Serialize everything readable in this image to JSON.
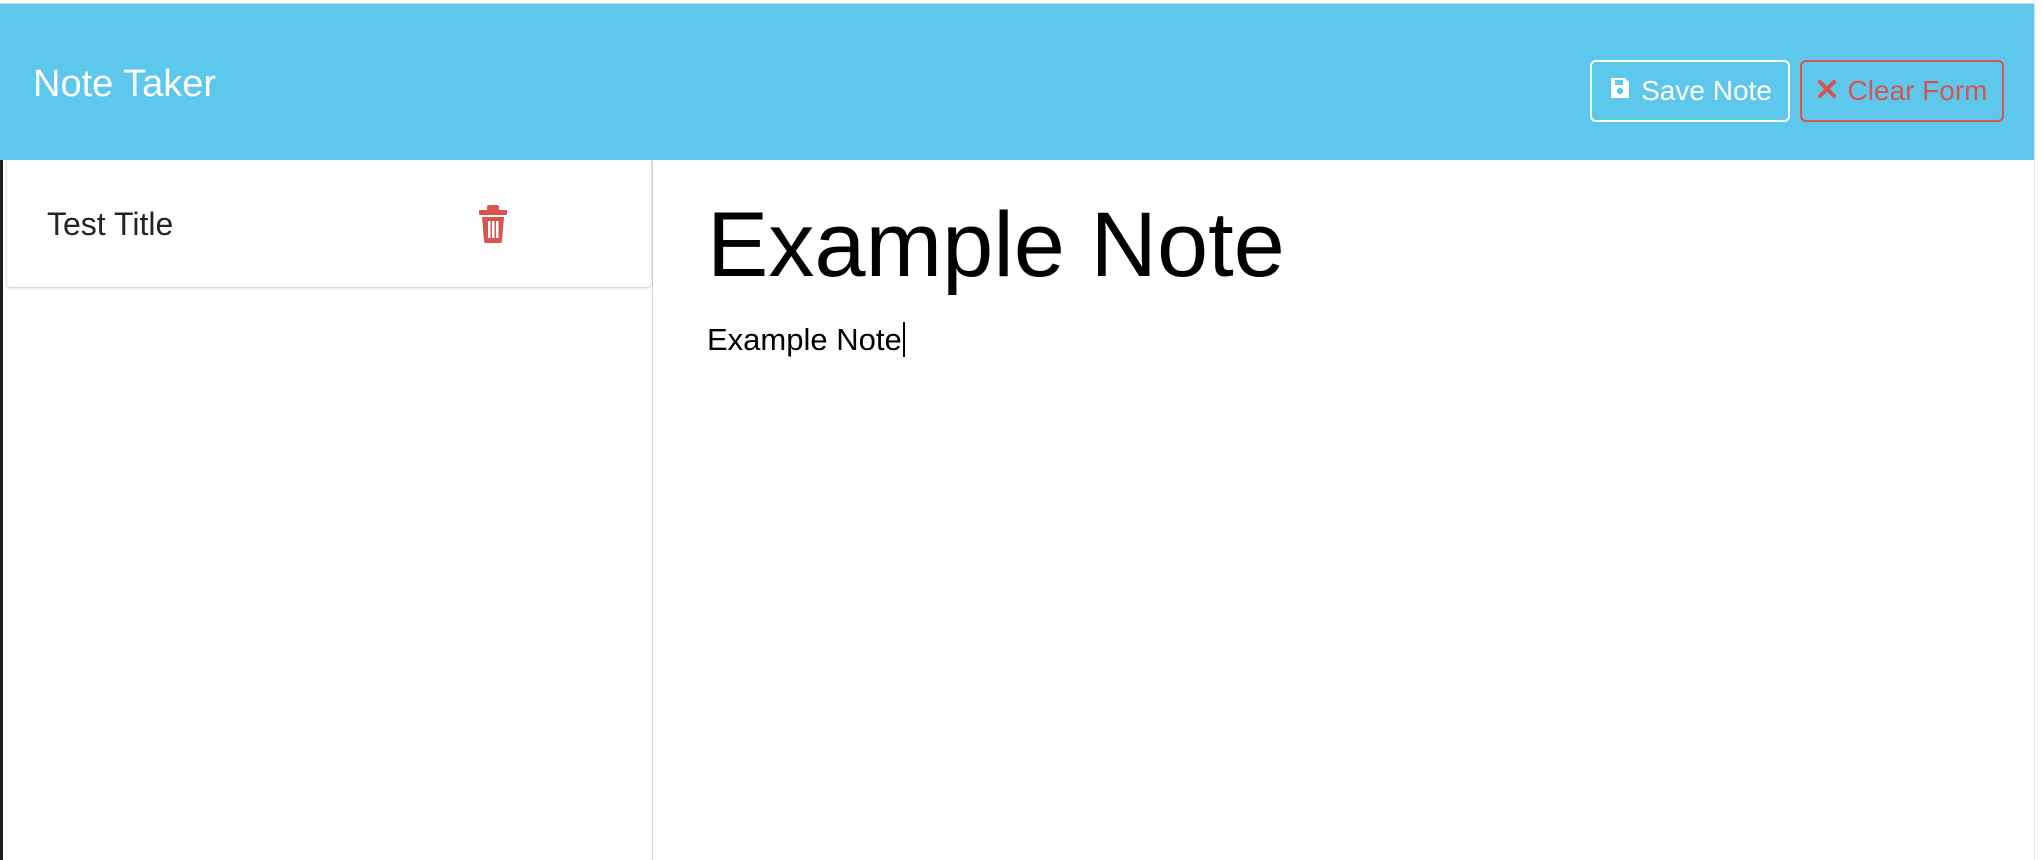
{
  "header": {
    "title": "Note Taker",
    "save_label": "Save Note",
    "clear_label": "Clear Form",
    "background_color": "#5dc7ec",
    "save_icon": "save-icon",
    "clear_icon": "close-icon"
  },
  "sidebar": {
    "notes": [
      {
        "title": "Test Title",
        "action_icon": "trash-icon",
        "action_color": "#d9534f"
      }
    ]
  },
  "editor": {
    "title": "Example Note",
    "body": "Example Note"
  }
}
